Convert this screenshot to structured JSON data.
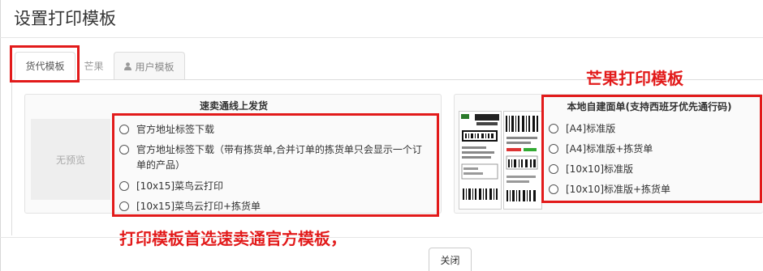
{
  "modal": {
    "title": "设置打印模板"
  },
  "tabs": [
    {
      "label": "货代模板"
    },
    {
      "label": "芒果"
    },
    {
      "label": "用户模板"
    }
  ],
  "left_panel": {
    "title": "速卖通线上发货",
    "no_preview": "无预览",
    "options": [
      {
        "label": "官方地址标签下载"
      },
      {
        "label": "官方地址标签下载（带有拣货单,合并订单的拣货单只会显示一个订单的产品）"
      },
      {
        "label": "[10x15]菜鸟云打印"
      },
      {
        "label": "[10x15]菜鸟云打印+拣货单"
      }
    ]
  },
  "right_panel": {
    "title": "本地自建面单(支持西班牙优先通行码)",
    "options": [
      {
        "label": "[A4]标准版"
      },
      {
        "label": "[A4]标准版+拣货单"
      },
      {
        "label": "[10x10]标准版"
      },
      {
        "label": "[10x10]标准版+拣货单"
      }
    ]
  },
  "annotations": {
    "mango": "芒果打印模板",
    "prefer": "打印模板首选速卖通官方模板，",
    "color": "#e21a1a"
  },
  "footer": {
    "close_label": "关闭"
  }
}
